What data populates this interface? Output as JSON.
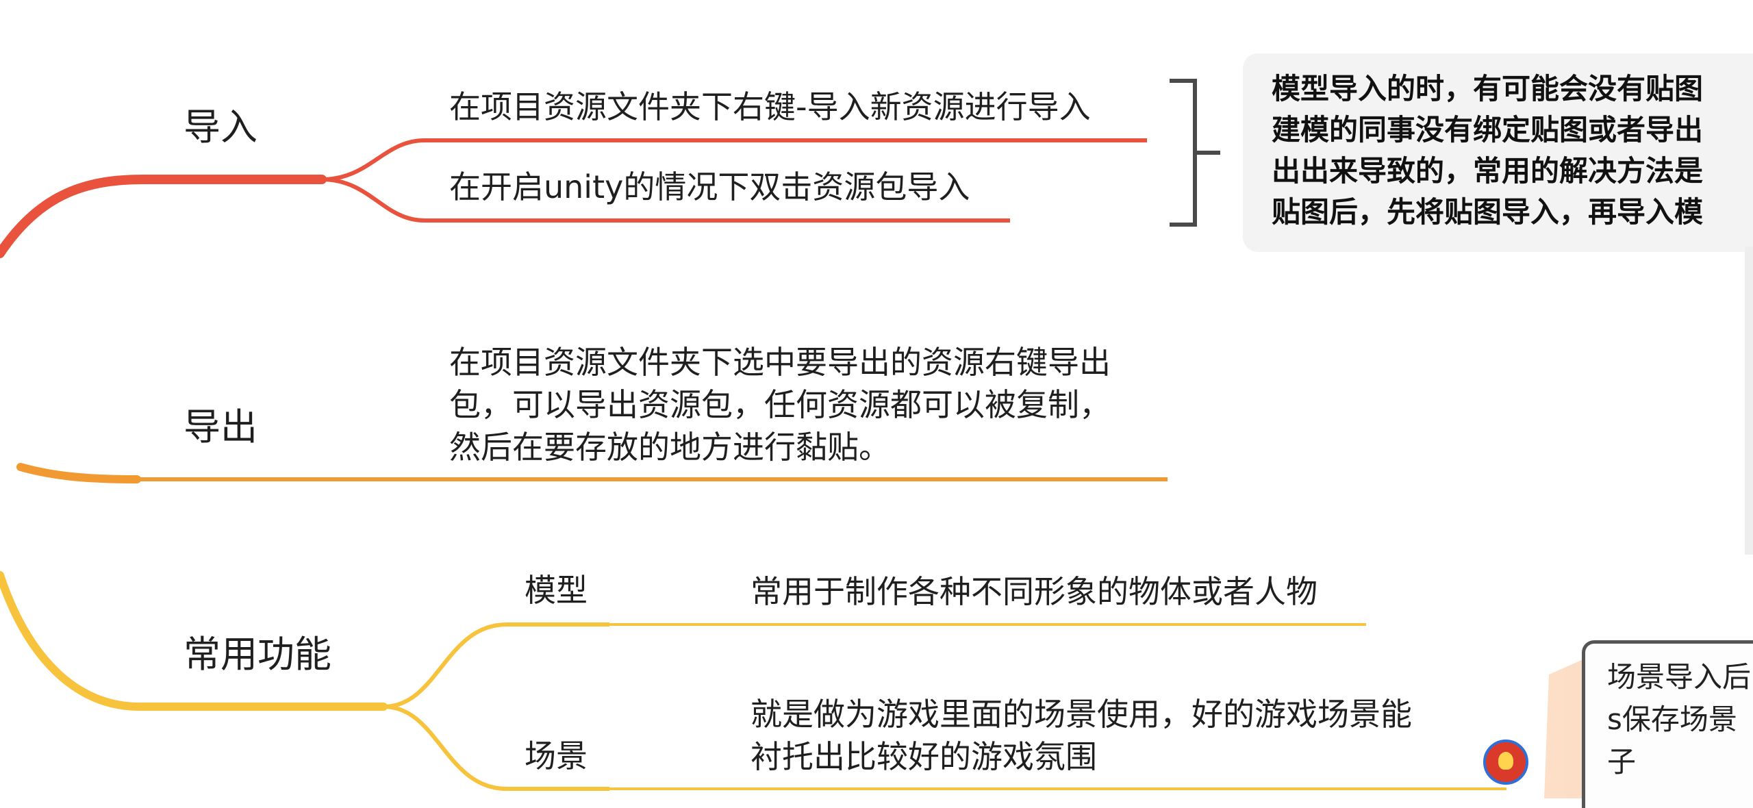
{
  "branches": {
    "import": {
      "label": "导入",
      "color": "#e9523c",
      "items": [
        "在项目资源文件夹下右键-导入新资源进行导入",
        "在开启unity的情况下双击资源包导入"
      ]
    },
    "export": {
      "label": "导出",
      "color": "#f29a32",
      "text_lines": [
        "在项目资源文件夹下选中要导出的资源右键导出",
        "包，可以导出资源包，任何资源都可以被复制，",
        "然后在要存放的地方进行黏贴。"
      ]
    },
    "common": {
      "label": "常用功能",
      "color": "#f7c33c",
      "model": {
        "label": "模型",
        "desc": "常用于制作各种不同形象的物体或者人物"
      },
      "scene": {
        "label": "场景",
        "desc_lines": [
          "就是做为游戏里面的场景使用，好的游戏场景能",
          "衬托出比较好的游戏氛围"
        ]
      }
    }
  },
  "callout": {
    "lines": [
      "模型导入的时，有可能会没有贴图",
      "建模的同事没有绑定贴图或者导出",
      "出出来导致的，常用的解决方法是",
      "贴图后，先将贴图导入，再导入模"
    ]
  },
  "side_note": {
    "lines": [
      "场景导入后",
      "s保存场景",
      "子"
    ]
  }
}
